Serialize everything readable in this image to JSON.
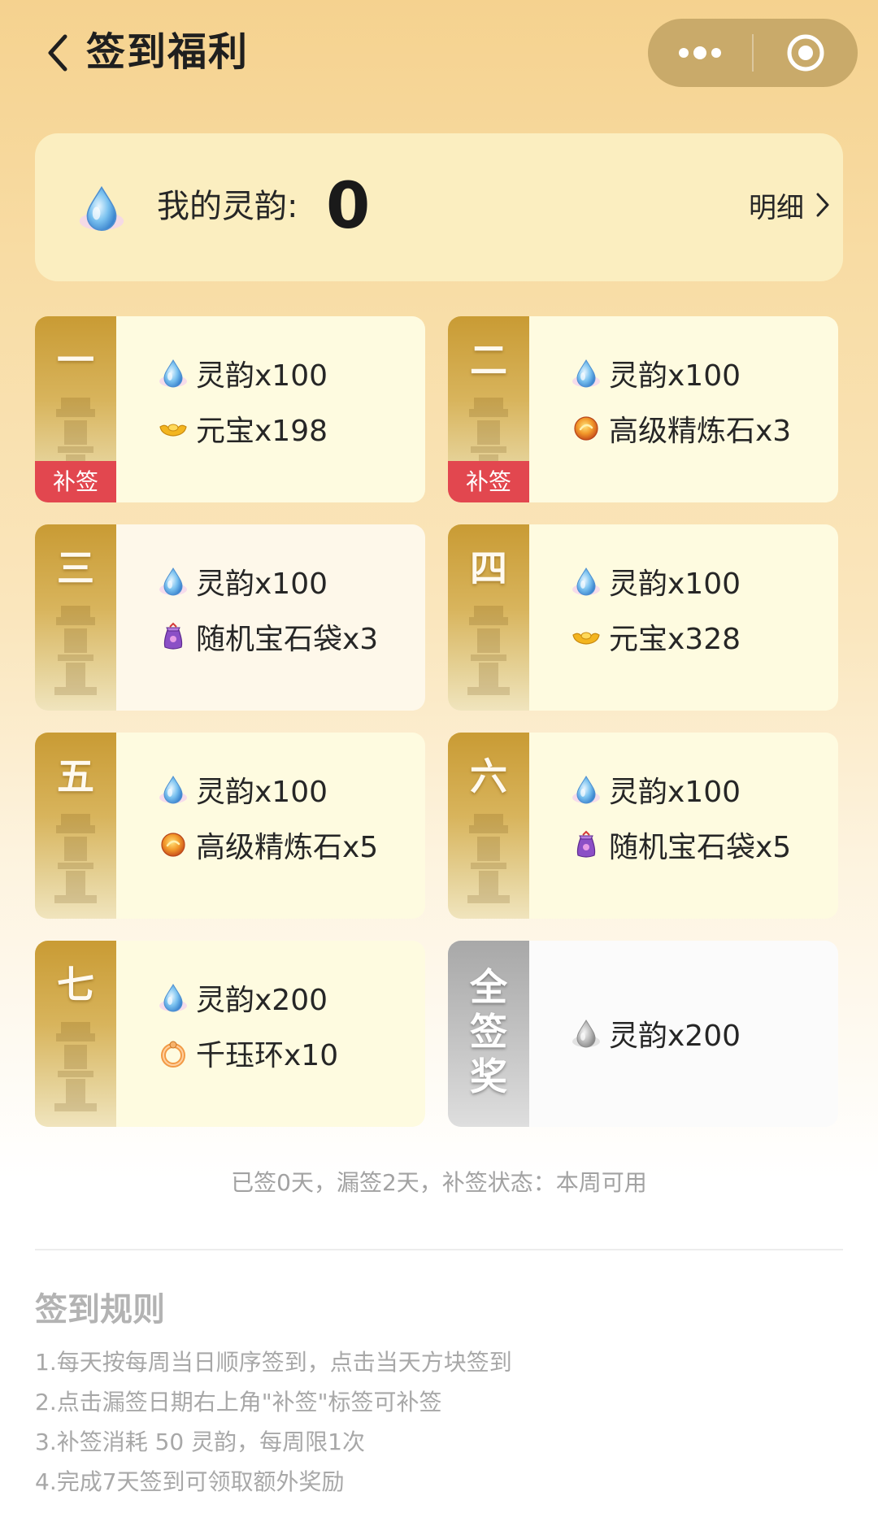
{
  "header": {
    "title": "签到福利"
  },
  "balance": {
    "label": "我的灵韵:",
    "value": "0",
    "detail": "明细"
  },
  "days": [
    {
      "day": "一",
      "makeup": "补签",
      "rewards": [
        {
          "icon": "spirit-drop-icon",
          "text": "灵韵x100"
        },
        {
          "icon": "gold-ingot-icon",
          "text": "元宝x198"
        }
      ]
    },
    {
      "day": "二",
      "makeup": "补签",
      "rewards": [
        {
          "icon": "spirit-drop-icon",
          "text": "灵韵x100"
        },
        {
          "icon": "refining-stone-icon",
          "text": "高级精炼石x3"
        }
      ]
    },
    {
      "day": "三",
      "rewards": [
        {
          "icon": "spirit-drop-icon",
          "text": "灵韵x100"
        },
        {
          "icon": "gem-bag-icon",
          "text": "随机宝石袋x3"
        }
      ]
    },
    {
      "day": "四",
      "rewards": [
        {
          "icon": "spirit-drop-icon",
          "text": "灵韵x100"
        },
        {
          "icon": "gold-ingot-icon",
          "text": "元宝x328"
        }
      ]
    },
    {
      "day": "五",
      "rewards": [
        {
          "icon": "spirit-drop-icon",
          "text": "灵韵x100"
        },
        {
          "icon": "refining-stone-icon",
          "text": "高级精炼石x5"
        }
      ]
    },
    {
      "day": "六",
      "rewards": [
        {
          "icon": "spirit-drop-icon",
          "text": "灵韵x100"
        },
        {
          "icon": "gem-bag-icon",
          "text": "随机宝石袋x5"
        }
      ]
    },
    {
      "day": "七",
      "rewards": [
        {
          "icon": "spirit-drop-icon",
          "text": "灵韵x200"
        },
        {
          "icon": "jade-ring-icon",
          "text": "千珏环x10"
        }
      ]
    }
  ],
  "full_bonus": {
    "label_1": "全",
    "label_2": "签",
    "label_3": "奖",
    "reward": {
      "icon": "spirit-drop-gray-icon",
      "text": "灵韵x200"
    }
  },
  "status": "已签0天，漏签2天，补签状态：本周可用",
  "rules": {
    "title": "签到规则",
    "items": [
      "1.每天按每周当日顺序签到，点击当天方块签到",
      "2.点击漏签日期右上角\"补签\"标签可补签",
      "3.补签消耗 50 灵韵，每周限1次",
      "4.完成7天签到可领取额外奖励"
    ]
  },
  "colors": {
    "accent_red": "#e2474f",
    "gold_strip": "#c99b34",
    "card_bg": "#fefbe0",
    "page_top": "#f5d28f"
  }
}
